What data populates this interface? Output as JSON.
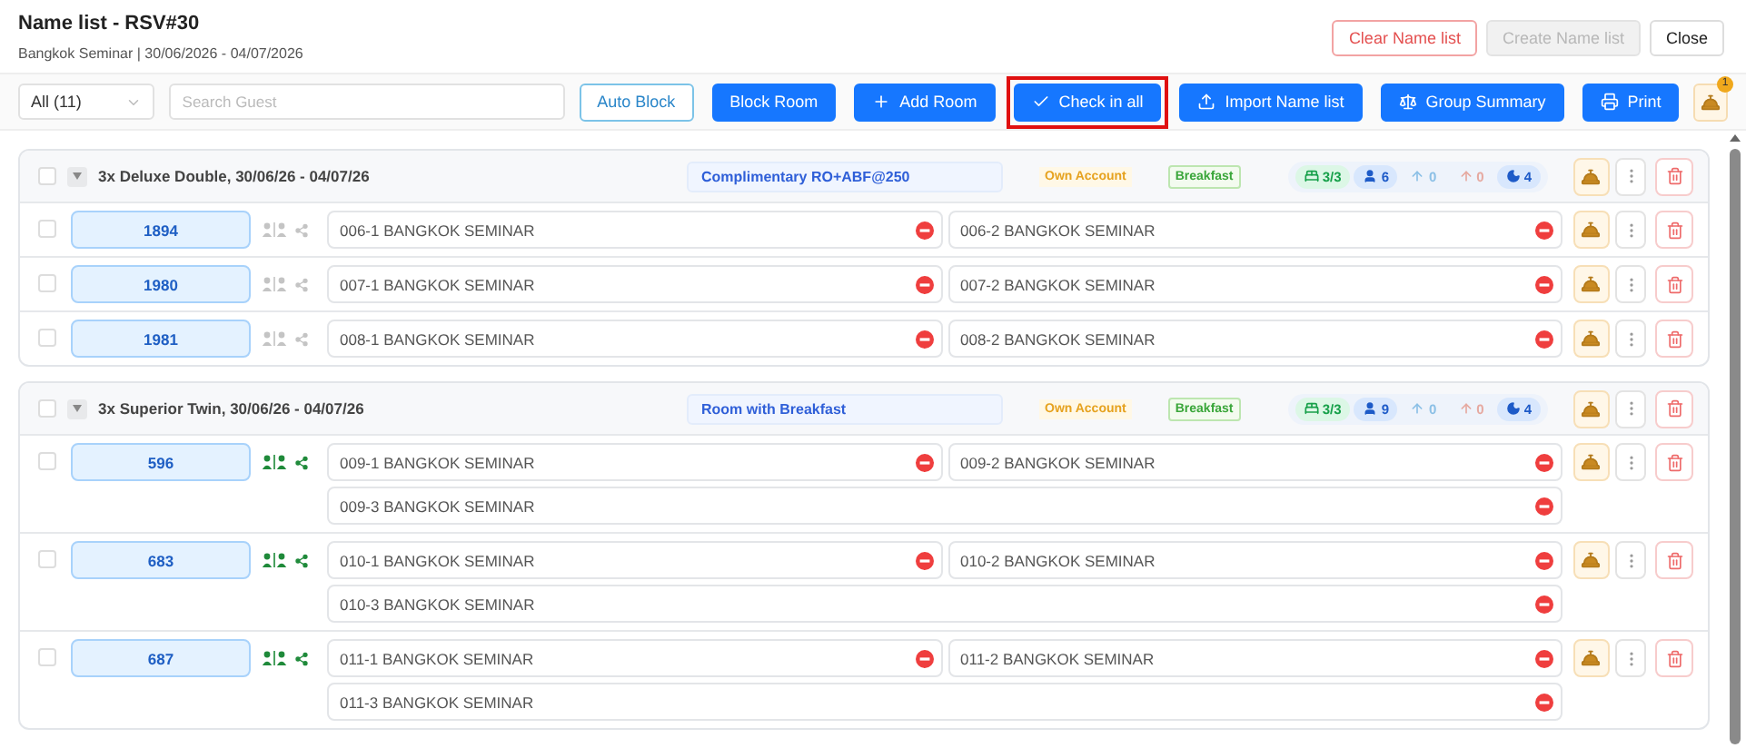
{
  "header": {
    "title": "Name list - RSV#30",
    "subtitle": "Bangkok Seminar | 30/06/2026 - 04/07/2026",
    "buttons": [
      {
        "label": "Clear Name list",
        "kind": "danger"
      },
      {
        "label": "Create Name list",
        "kind": "disabled"
      },
      {
        "label": "Close",
        "kind": "default"
      }
    ]
  },
  "toolbar": {
    "filter": {
      "value": "All (11)"
    },
    "search": {
      "placeholder": "Search Guest"
    },
    "buttons": [
      {
        "label": "Auto Block",
        "kind": "auto",
        "highlighted": false
      },
      {
        "label": "Block Room",
        "kind": "block",
        "highlighted": false
      },
      {
        "label": "Add Room",
        "kind": "add",
        "highlighted": false
      },
      {
        "label": "Check in all",
        "kind": "checkin",
        "highlighted": true
      },
      {
        "label": "Import Name list",
        "kind": "import",
        "highlighted": false
      },
      {
        "label": "Group Summary",
        "kind": "summary",
        "highlighted": false
      },
      {
        "label": "Print",
        "kind": "print",
        "highlighted": false
      }
    ],
    "bell": {
      "badge": "1"
    }
  },
  "groups": [
    {
      "title": "3x Deluxe Double, 30/06/26 - 04/07/26",
      "checked": false,
      "expanded": true,
      "rate": "Complimentary RO+ABF@250",
      "account": "Own Account",
      "meal": "Breakfast",
      "stats": [
        {
          "kind": "rooms",
          "value": "3/3"
        },
        {
          "kind": "guests",
          "value": "6"
        },
        {
          "kind": "male",
          "value": "0"
        },
        {
          "kind": "female",
          "value": "0"
        },
        {
          "kind": "nights",
          "value": "4"
        }
      ],
      "rooms": [
        {
          "number": "1894",
          "checked": false,
          "linked": false,
          "lines": [
            [
              "006-1 BANGKOK SEMINAR",
              "006-2 BANGKOK SEMINAR"
            ]
          ]
        },
        {
          "number": "1980",
          "checked": false,
          "linked": false,
          "lines": [
            [
              "007-1 BANGKOK SEMINAR",
              "007-2 BANGKOK SEMINAR"
            ]
          ]
        },
        {
          "number": "1981",
          "checked": false,
          "linked": false,
          "lines": [
            [
              "008-1 BANGKOK SEMINAR",
              "008-2 BANGKOK SEMINAR"
            ]
          ]
        }
      ]
    },
    {
      "title": "3x Superior Twin, 30/06/26 - 04/07/26",
      "checked": false,
      "expanded": true,
      "rate": "Room with Breakfast",
      "account": "Own Account",
      "meal": "Breakfast",
      "stats": [
        {
          "kind": "rooms",
          "value": "3/3"
        },
        {
          "kind": "guests",
          "value": "9"
        },
        {
          "kind": "male",
          "value": "0"
        },
        {
          "kind": "female",
          "value": "0"
        },
        {
          "kind": "nights",
          "value": "4"
        }
      ],
      "rooms": [
        {
          "number": "596",
          "checked": false,
          "linked": true,
          "lines": [
            [
              "009-1 BANGKOK SEMINAR",
              "009-2 BANGKOK SEMINAR"
            ],
            [
              "009-3 BANGKOK SEMINAR"
            ]
          ]
        },
        {
          "number": "683",
          "checked": false,
          "linked": true,
          "lines": [
            [
              "010-1 BANGKOK SEMINAR",
              "010-2 BANGKOK SEMINAR"
            ],
            [
              "010-3 BANGKOK SEMINAR"
            ]
          ]
        },
        {
          "number": "687",
          "checked": false,
          "linked": true,
          "lines": [
            [
              "011-1 BANGKOK SEMINAR",
              "011-2 BANGKOK SEMINAR"
            ],
            [
              "011-3 BANGKOK SEMINAR"
            ]
          ]
        }
      ]
    }
  ]
}
